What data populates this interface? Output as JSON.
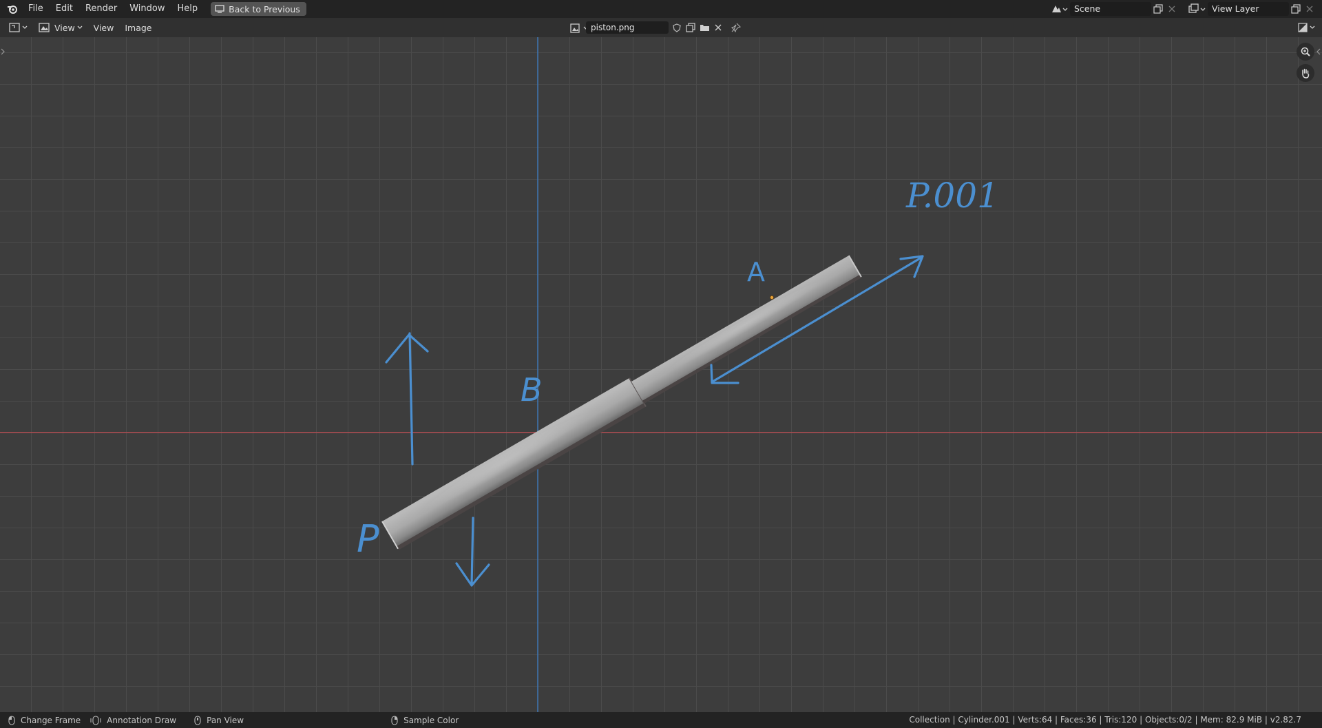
{
  "menu": {
    "items": [
      "File",
      "Edit",
      "Render",
      "Window",
      "Help"
    ],
    "back_button": "Back to Previous"
  },
  "scene": {
    "label": "Scene"
  },
  "view_layer": {
    "label": "View Layer"
  },
  "header": {
    "view_dropdown": "View",
    "view_menu": "View",
    "image_menu": "Image",
    "image_name": "piston.png"
  },
  "annotations": {
    "label_p001": "P.001",
    "label_a": "A",
    "label_b": "B",
    "label_p": "P"
  },
  "status": {
    "hint1": "Change Frame",
    "hint2": "Annotation Draw",
    "hint3": "Pan View",
    "hint4": "Sample Color",
    "stats": "Collection  | Cylinder.001 | Verts:64 | Faces:36 | Tris:120 | Objects:0/2 | Mem: 82.9 MiB | v2.82.7"
  },
  "colors": {
    "annotation": "#4b8fd0",
    "x_axis": "#b34c52",
    "y_axis": "#3f73ad",
    "background": "#3d3d3d"
  }
}
